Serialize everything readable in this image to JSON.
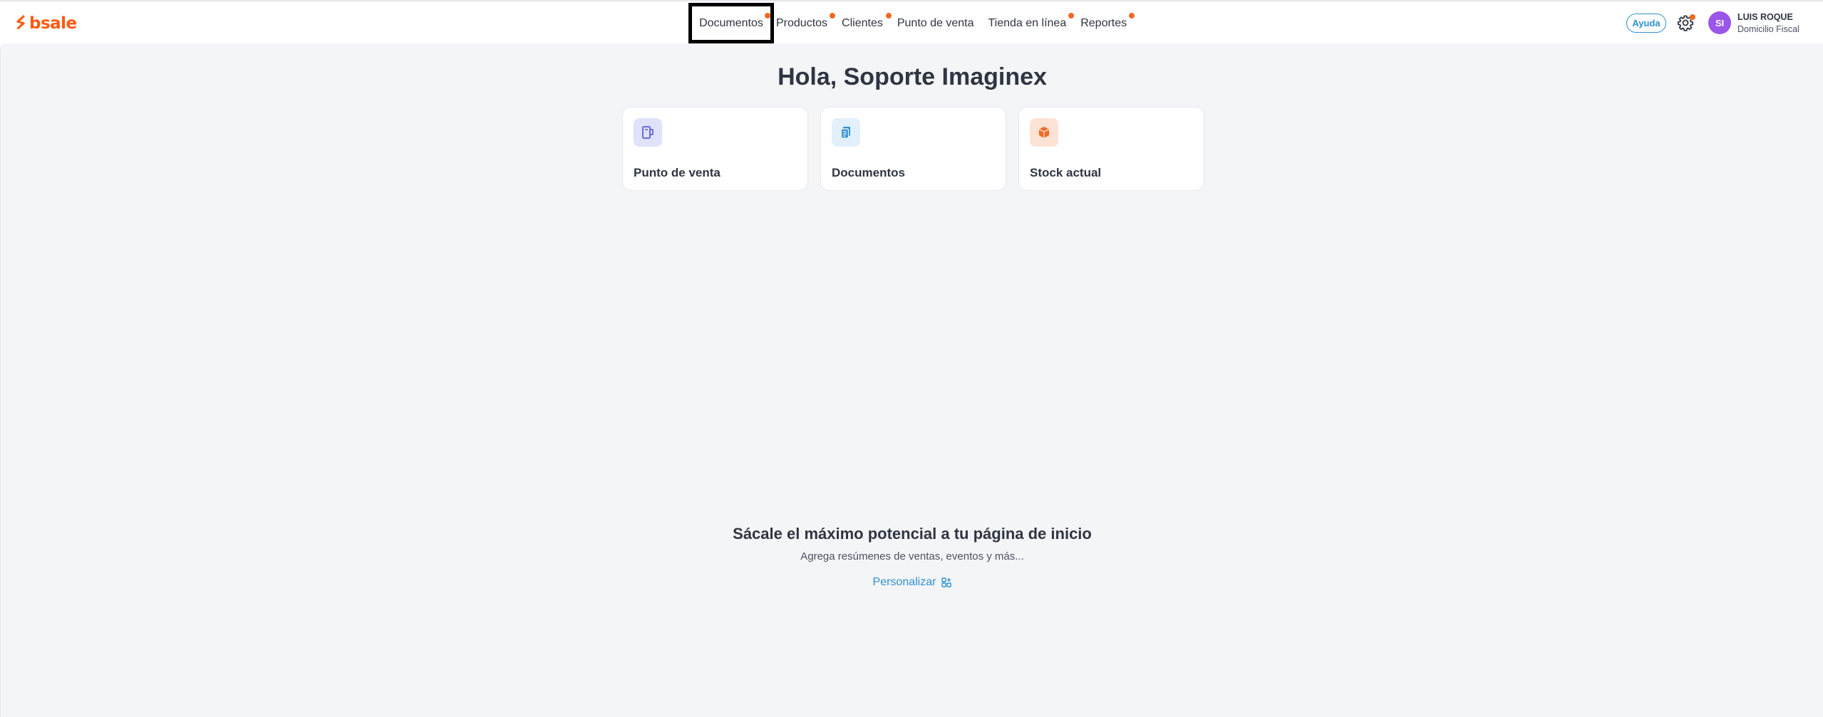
{
  "brand": {
    "logo_text": "bsale",
    "accent": "#ff5a10"
  },
  "nav": {
    "items": [
      {
        "label": "Documentos",
        "has_dot": true,
        "active": true
      },
      {
        "label": "Productos",
        "has_dot": true
      },
      {
        "label": "Clientes",
        "has_dot": true
      },
      {
        "label": "Punto de venta",
        "has_dot": false
      },
      {
        "label": "Tienda en línea",
        "has_dot": true
      },
      {
        "label": "Reportes",
        "has_dot": true
      }
    ]
  },
  "header": {
    "help_label": "Ayuda",
    "settings_icon": "gear-icon",
    "avatar_initials": "SI",
    "user_name": "LUIS ROQUE",
    "user_subtitle": "Domicilio Fiscal"
  },
  "home": {
    "greeting": "Hola, Soporte Imaginex",
    "cards": [
      {
        "label": "Punto de venta",
        "icon": "pos-terminal-icon",
        "icon_bg": "#e0e1fb",
        "icon_color": "#5b5fe0"
      },
      {
        "label": "Documentos",
        "icon": "document-icon",
        "icon_bg": "#e1f0fa",
        "icon_color": "#2e90d1"
      },
      {
        "label": "Stock actual",
        "icon": "box-icon",
        "icon_bg": "#fde2d6",
        "icon_color": "#f06a23"
      }
    ],
    "promo_title": "Sácale el máximo potencial a tu página de inicio",
    "promo_subtitle": "Agrega resúmenes de ventas, eventos y más...",
    "personalize_label": "Personalizar"
  }
}
